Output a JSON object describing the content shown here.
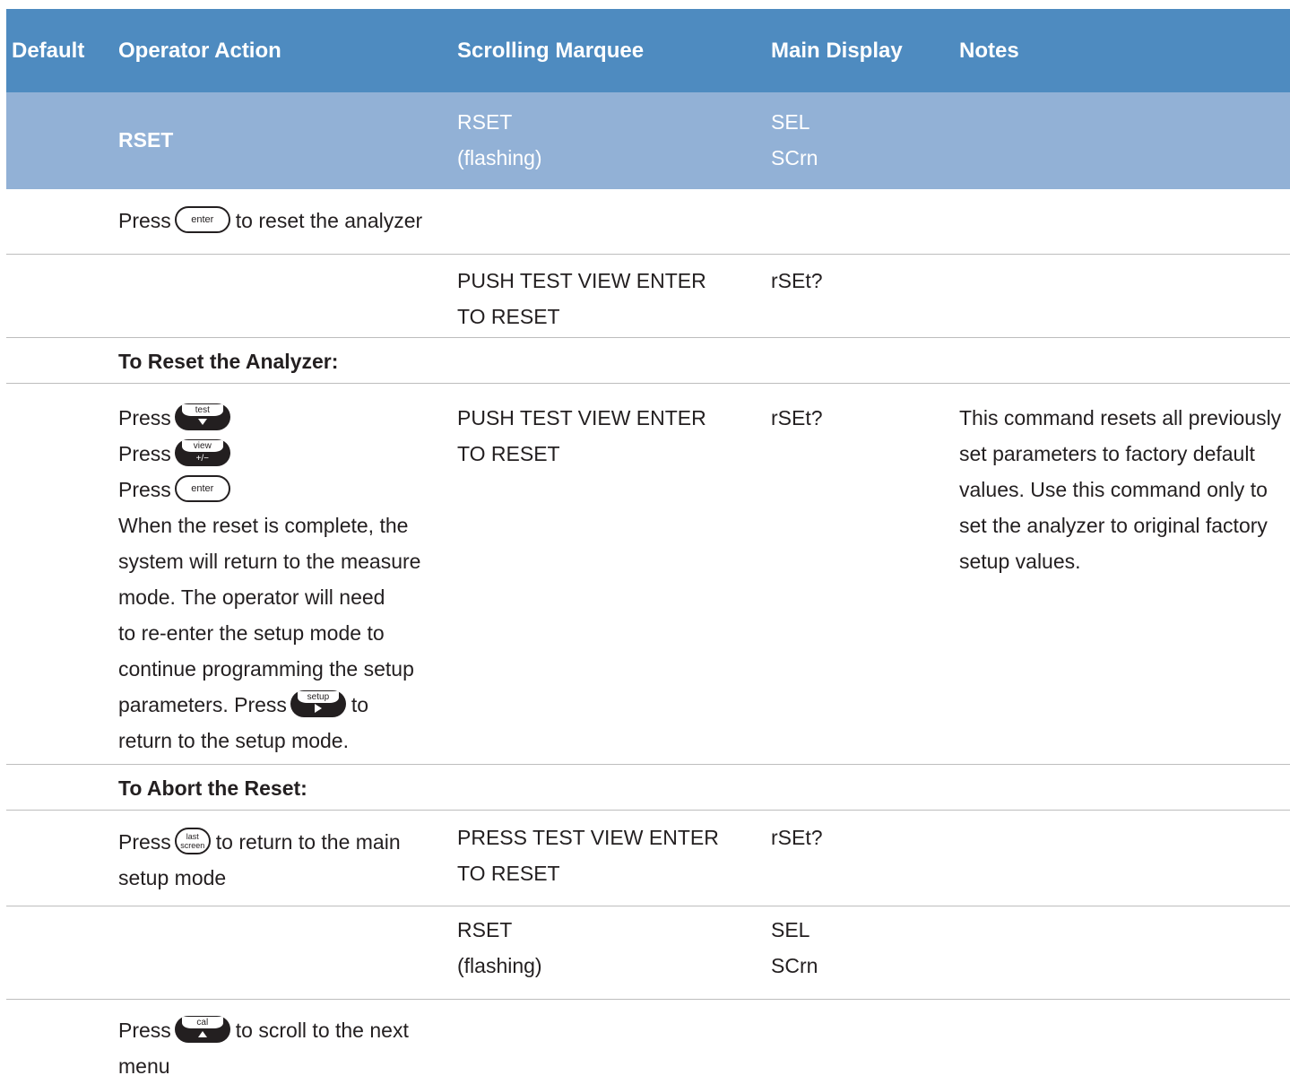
{
  "header": {
    "default": "Default",
    "operator_action": "Operator Action",
    "scrolling_marquee": "Scrolling Marquee",
    "main_display": "Main Display",
    "notes": "Notes"
  },
  "menu_row": {
    "action": "RSET",
    "marquee_line1": "RSET",
    "marquee_line2": "(flashing)",
    "display_line1": "SEL",
    "display_line2": "SCrn"
  },
  "row_enter": {
    "press": "Press",
    "button": "enter",
    "text": "to reset the analyzer"
  },
  "row_push1": {
    "marquee_line1": "PUSH TEST VIEW ENTER",
    "marquee_line2": "TO RESET",
    "display": "rSEt?"
  },
  "section_reset": "To Reset the Analyzer:",
  "row_reset": {
    "press1": "Press",
    "btn_test": "test",
    "press2": "Press",
    "btn_view": "view",
    "btn_view_sub": "+/−",
    "press3": "Press",
    "btn_enter": "enter",
    "lines": [
      "When the reset is complete, the",
      "system will return to the measure",
      "mode. The operator will need",
      "to re-enter the setup mode to",
      "continue programming the setup"
    ],
    "params_text": "parameters. Press",
    "btn_setup": "setup",
    "to": "to",
    "last_line": "return to the setup mode.",
    "marquee_line1": "PUSH TEST VIEW ENTER",
    "marquee_line2": "TO RESET",
    "display": "rSEt?",
    "notes": [
      "This command resets all previously",
      "set parameters to factory default",
      "values. Use this command only to",
      "set the analyzer to original factory",
      "setup values."
    ]
  },
  "section_abort": "To Abort the Reset:",
  "row_abort": {
    "press": "Press",
    "btn_last1": "last",
    "btn_last2": "screen",
    "text1": "to return to the main",
    "text2": "setup mode",
    "marquee_line1": "PRESS TEST VIEW ENTER",
    "marquee_line2": "TO RESET",
    "display": "rSEt?"
  },
  "row_rset": {
    "marquee_line1": "RSET",
    "marquee_line2": "(flashing)",
    "display_line1": "SEL",
    "display_line2": "SCrn"
  },
  "row_cal": {
    "press": "Press",
    "btn_cal": "cal",
    "text1": "to scroll to the next",
    "text2": "menu"
  }
}
